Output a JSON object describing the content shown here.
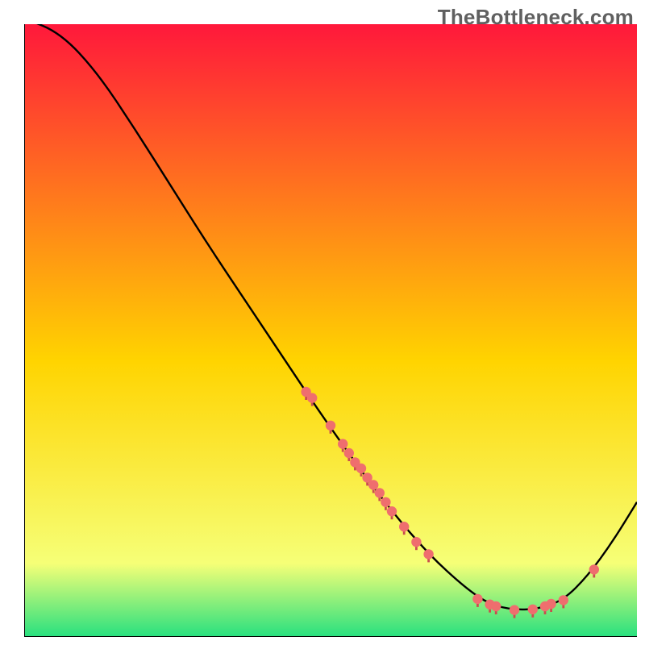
{
  "watermark": "TheBottleneck.com",
  "chart_data": {
    "type": "line",
    "title": "",
    "xlabel": "",
    "ylabel": "",
    "xlim": [
      0,
      100
    ],
    "ylim": [
      0,
      100
    ],
    "grid": false,
    "curve": {
      "name": "bottleneck-curve",
      "x": [
        0,
        6,
        12,
        18,
        24,
        30,
        36,
        42,
        48,
        54,
        60,
        66,
        72,
        76,
        80,
        84,
        88,
        92,
        96,
        100
      ],
      "y": [
        101,
        98.5,
        92,
        83,
        73.5,
        64,
        55,
        46,
        37,
        28.5,
        20.5,
        13.5,
        8,
        5.3,
        4.4,
        4.6,
        6,
        10,
        15.5,
        22
      ]
    },
    "scatter": {
      "name": "highlighted-points",
      "x": [
        46,
        47,
        50,
        52,
        53,
        54,
        55,
        56,
        57,
        58,
        59,
        60,
        62,
        64,
        66,
        74,
        76,
        77,
        80,
        83,
        85,
        86,
        88,
        93
      ],
      "y": [
        40,
        39,
        34.5,
        31.5,
        30,
        28.5,
        27.5,
        26,
        24.8,
        23.5,
        22,
        20.5,
        18,
        15.5,
        13.5,
        6.2,
        5.3,
        5,
        4.4,
        4.5,
        5,
        5.4,
        6,
        11
      ]
    },
    "gradient": {
      "top_color": "#ff183b",
      "mid1_color": "#ffd400",
      "mid2_color": "#f6ff77",
      "bottom_color": "#27e07f"
    }
  }
}
